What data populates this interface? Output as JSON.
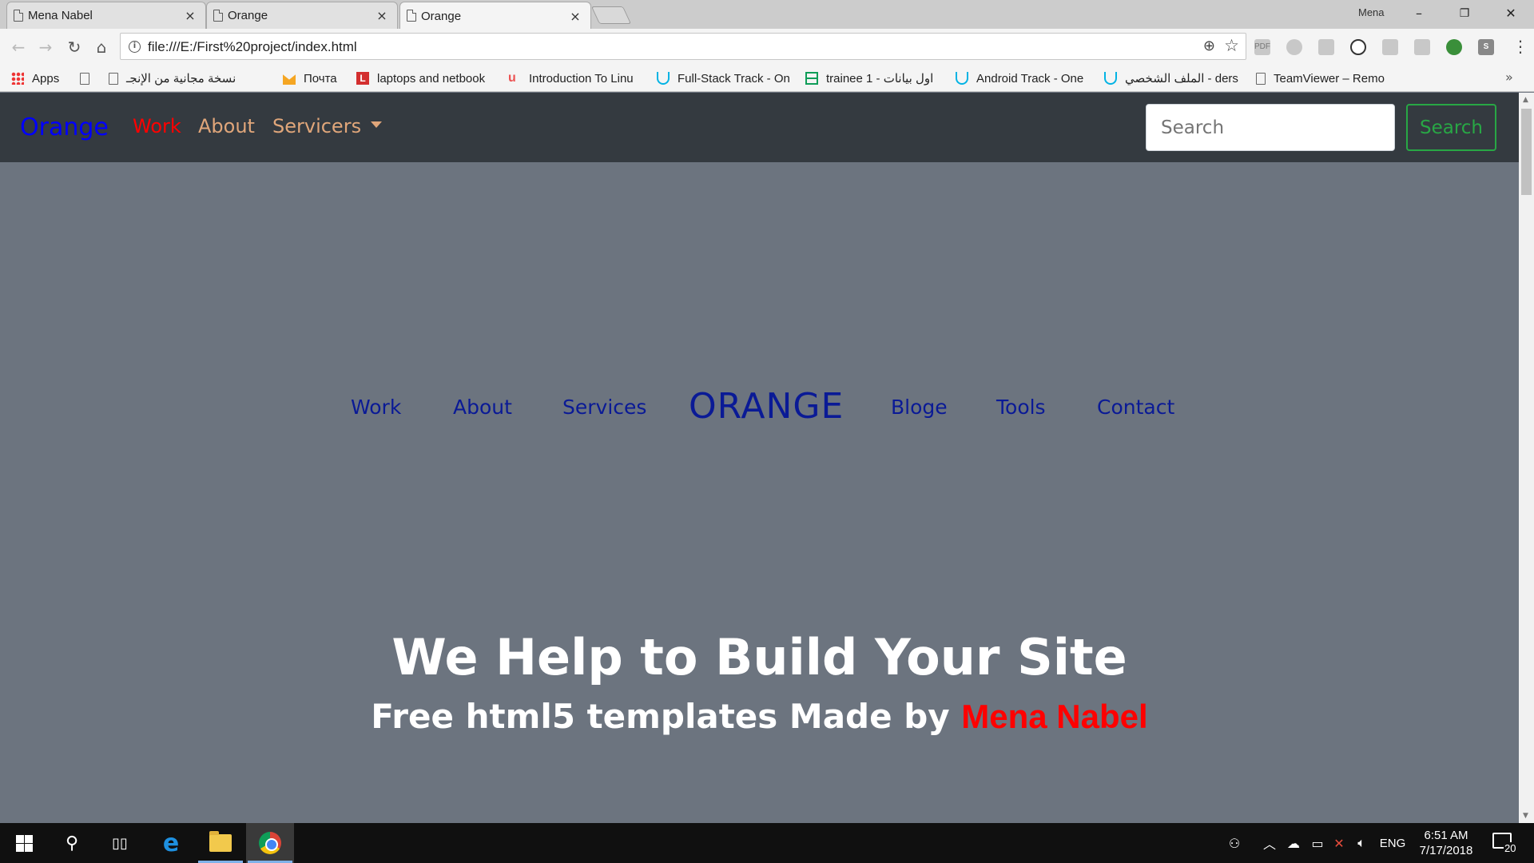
{
  "browser": {
    "tabs": [
      {
        "title": "Mena Nabel",
        "active": false
      },
      {
        "title": "Orange",
        "active": false
      },
      {
        "title": "Orange",
        "active": true
      }
    ],
    "tab_close_glyph": "×",
    "profile_name": "Mena",
    "window_controls": {
      "minimize": "–",
      "maximize": "❐",
      "close": "✕"
    },
    "address_bar": {
      "url": "file:///E:/First%20project/index.html"
    },
    "bookmarks": [
      {
        "label": "Apps",
        "icon": "apps-grid-icon"
      },
      {
        "label": "",
        "icon": "page-icon"
      },
      {
        "label": "نسخة مجانية من الإنجـ",
        "icon": "page-icon"
      },
      {
        "label": "Почта",
        "icon": "mail-icon"
      },
      {
        "label": "laptops and netbook",
        "icon": "l-icon"
      },
      {
        "label": "Introduction To Linu",
        "icon": "udemy-icon"
      },
      {
        "label": "Full-Stack Track - On",
        "icon": "udacity-icon"
      },
      {
        "label": "trainee 1 - اول بيانات",
        "icon": "sheets-icon"
      },
      {
        "label": "Android Track - One",
        "icon": "udacity-icon"
      },
      {
        "label": "الملف الشخصي - ders",
        "icon": "udacity-icon"
      },
      {
        "label": "TeamViewer – Remo",
        "icon": "page-icon"
      }
    ],
    "bookmarks_overflow": "»"
  },
  "site": {
    "navbar": {
      "brand": "Orange",
      "links": [
        {
          "label": "Work",
          "active": true
        },
        {
          "label": "About",
          "active": false
        },
        {
          "label": "Servicers",
          "dropdown": true
        }
      ],
      "search_placeholder": "Search",
      "search_button": "Search"
    },
    "center_nav": {
      "left": [
        "Work",
        "About",
        "Services"
      ],
      "logo": "ORANGE",
      "right": [
        "Bloge",
        "Tools",
        "Contact"
      ]
    },
    "hero": {
      "title": "We Help to Build Your Site",
      "subtitle_prefix": "Free html5 templates Made by",
      "subtitle_author": "Mena Nabel"
    }
  },
  "taskbar": {
    "language": "ENG",
    "time": "6:51 AM",
    "date": "7/17/2018",
    "notification_count": "20"
  },
  "colors": {
    "page_bg": "#6c747f",
    "navbar_bg": "#343a40",
    "brand": "#0000ff",
    "active_link": "#ff0000",
    "nav_link": "#e0a67a",
    "center_nav": "#0a1a96",
    "search_button": "#28a745",
    "author": "#ff0000"
  }
}
